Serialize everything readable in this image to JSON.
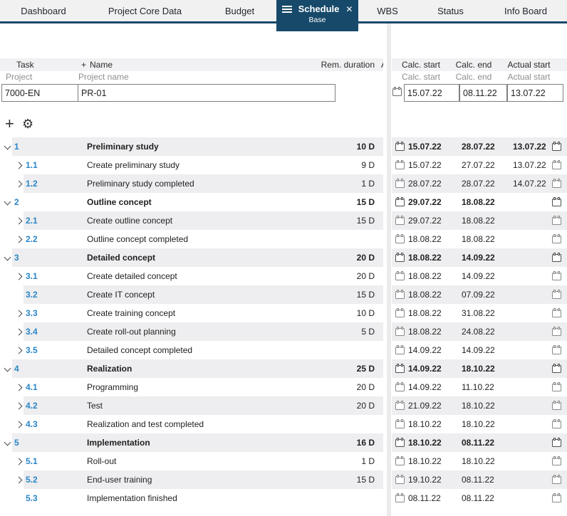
{
  "tabbar": {
    "tabs": [
      {
        "label": "Dashboard",
        "active": false
      },
      {
        "label": "Project Core Data",
        "active": false
      },
      {
        "label": "Budget",
        "active": false
      },
      {
        "label": "Schedule",
        "active": true,
        "sublabel": "Base"
      },
      {
        "label": "WBS",
        "active": false
      },
      {
        "label": "Status",
        "active": false
      },
      {
        "label": "Info Board",
        "active": false
      }
    ],
    "close_glyph": "✕"
  },
  "table": {
    "header": {
      "task": "Task",
      "plus": "+",
      "name": "Name",
      "rem_duration": "Rem. duration",
      "clipped": "A",
      "calc_start": "Calc. start",
      "calc_end": "Calc. end",
      "actual_start": "Actual start"
    },
    "filter_labels": {
      "task": "Project",
      "name": "Project name",
      "calc_start": "Calc. start",
      "calc_end": "Calc. end",
      "actual_start": "Actual start"
    },
    "filter_values": {
      "task": "7000-EN",
      "name": "PR-01",
      "calc_start": "15.07.22",
      "calc_end": "08.11.22",
      "actual_start": "13.07.22"
    }
  },
  "toolbar": {
    "add_glyph": "+",
    "settings_glyph": "⚙"
  },
  "colors": {
    "accent": "#17496A",
    "number_blue": "#2A86C7",
    "row_shade": "#EEEEF0",
    "header_bg": "#F1F1F3",
    "tabbar_bg": "#F1F1F2"
  },
  "tasks": [
    {
      "number": "1",
      "name": "Preliminary study",
      "duration": "10 D",
      "calc_start": "15.07.22",
      "calc_end": "28.07.22",
      "actual_start": "13.07.22",
      "level": 1,
      "summary": true,
      "chevron": "down"
    },
    {
      "number": "1.1",
      "name": "Create preliminary study",
      "duration": "9 D",
      "calc_start": "15.07.22",
      "calc_end": "27.07.22",
      "actual_start": "13.07.22",
      "level": 2,
      "summary": false,
      "chevron": "right"
    },
    {
      "number": "1.2",
      "name": "Preliminary study completed",
      "duration": "1 D",
      "calc_start": "28.07.22",
      "calc_end": "28.07.22",
      "actual_start": "14.07.22",
      "level": 2,
      "summary": false,
      "chevron": "right"
    },
    {
      "number": "2",
      "name": "Outline concept",
      "duration": "15 D",
      "calc_start": "29.07.22",
      "calc_end": "18.08.22",
      "actual_start": "",
      "level": 1,
      "summary": true,
      "chevron": "down"
    },
    {
      "number": "2.1",
      "name": "Create outline concept",
      "duration": "15 D",
      "calc_start": "29.07.22",
      "calc_end": "18.08.22",
      "actual_start": "",
      "level": 2,
      "summary": false,
      "chevron": "right"
    },
    {
      "number": "2.2",
      "name": "Outline concept completed",
      "duration": "",
      "calc_start": "18.08.22",
      "calc_end": "18.08.22",
      "actual_start": "",
      "level": 2,
      "summary": false,
      "chevron": "right"
    },
    {
      "number": "3",
      "name": "Detailed concept",
      "duration": "20 D",
      "calc_start": "18.08.22",
      "calc_end": "14.09.22",
      "actual_start": "",
      "level": 1,
      "summary": true,
      "chevron": "down"
    },
    {
      "number": "3.1",
      "name": "Create detailed concept",
      "duration": "20 D",
      "calc_start": "18.08.22",
      "calc_end": "14.09.22",
      "actual_start": "",
      "level": 2,
      "summary": false,
      "chevron": "right"
    },
    {
      "number": "3.2",
      "name": "Create IT concept",
      "duration": "15 D",
      "calc_start": "18.08.22",
      "calc_end": "07.09.22",
      "actual_start": "",
      "level": 2,
      "summary": false,
      "chevron": "none"
    },
    {
      "number": "3.3",
      "name": "Create training concept",
      "duration": "10 D",
      "calc_start": "18.08.22",
      "calc_end": "31.08.22",
      "actual_start": "",
      "level": 2,
      "summary": false,
      "chevron": "right"
    },
    {
      "number": "3.4",
      "name": "Create roll-out planning",
      "duration": "5 D",
      "calc_start": "18.08.22",
      "calc_end": "24.08.22",
      "actual_start": "",
      "level": 2,
      "summary": false,
      "chevron": "right"
    },
    {
      "number": "3.5",
      "name": "Detailed concept completed",
      "duration": "",
      "calc_start": "14.09.22",
      "calc_end": "14.09.22",
      "actual_start": "",
      "level": 2,
      "summary": false,
      "chevron": "right"
    },
    {
      "number": "4",
      "name": "Realization",
      "duration": "25 D",
      "calc_start": "14.09.22",
      "calc_end": "18.10.22",
      "actual_start": "",
      "level": 1,
      "summary": true,
      "chevron": "down"
    },
    {
      "number": "4.1",
      "name": "Programming",
      "duration": "20 D",
      "calc_start": "14.09.22",
      "calc_end": "11.10.22",
      "actual_start": "",
      "level": 2,
      "summary": false,
      "chevron": "right"
    },
    {
      "number": "4.2",
      "name": "Test",
      "duration": "20 D",
      "calc_start": "21.09.22",
      "calc_end": "18.10.22",
      "actual_start": "",
      "level": 2,
      "summary": false,
      "chevron": "right"
    },
    {
      "number": "4.3",
      "name": "Realization and test completed",
      "duration": "",
      "calc_start": "18.10.22",
      "calc_end": "18.10.22",
      "actual_start": "",
      "level": 2,
      "summary": false,
      "chevron": "right"
    },
    {
      "number": "5",
      "name": "Implementation",
      "duration": "16 D",
      "calc_start": "18.10.22",
      "calc_end": "08.11.22",
      "actual_start": "",
      "level": 1,
      "summary": true,
      "chevron": "down"
    },
    {
      "number": "5.1",
      "name": "Roll-out",
      "duration": "1 D",
      "calc_start": "18.10.22",
      "calc_end": "18.10.22",
      "actual_start": "",
      "level": 2,
      "summary": false,
      "chevron": "right"
    },
    {
      "number": "5.2",
      "name": "End-user training",
      "duration": "15 D",
      "calc_start": "19.10.22",
      "calc_end": "08.11.22",
      "actual_start": "",
      "level": 2,
      "summary": false,
      "chevron": "right"
    },
    {
      "number": "5.3",
      "name": "Implementation finished",
      "duration": "",
      "calc_start": "08.11.22",
      "calc_end": "08.11.22",
      "actual_start": "",
      "level": 2,
      "summary": false,
      "chevron": "none"
    }
  ]
}
